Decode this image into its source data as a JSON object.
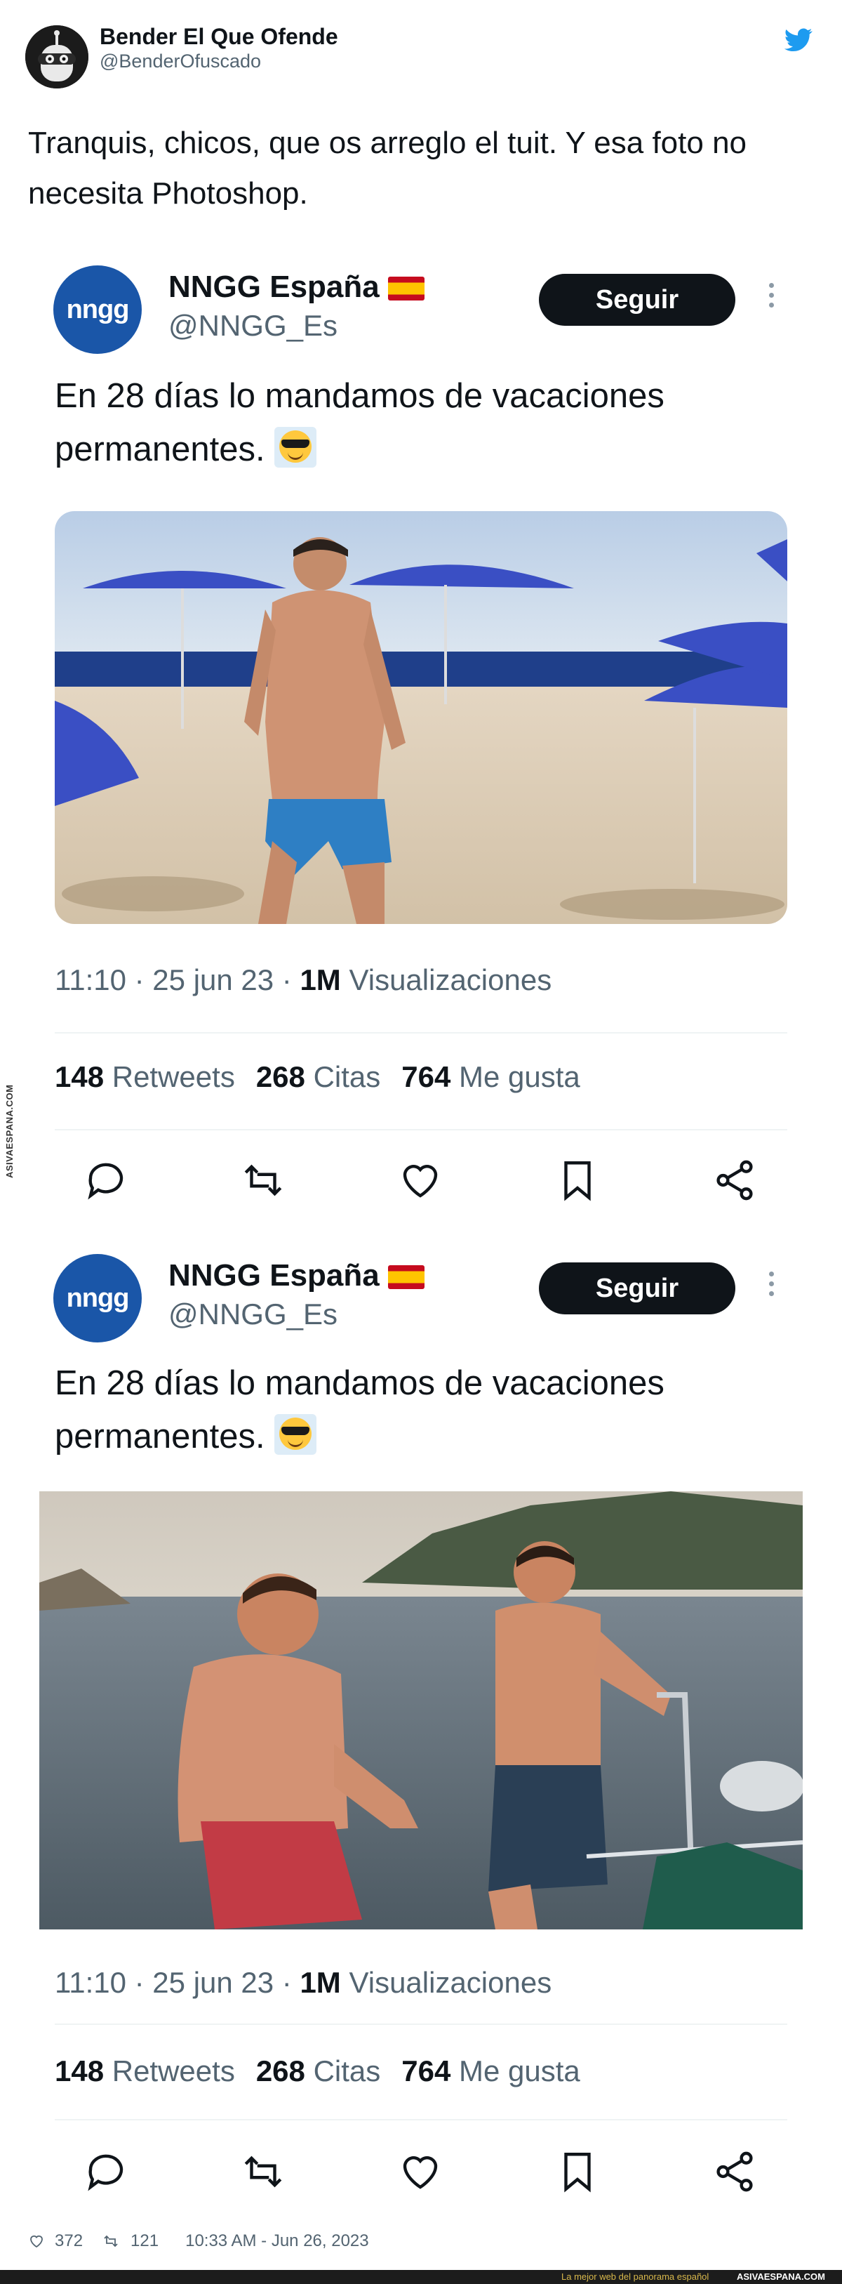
{
  "outer_tweet": {
    "author_name": "Bender El Que Ofende",
    "author_handle": "@BenderOfuscado",
    "text": "Tranquis, chicos, que os arreglo el tuit. Y esa foto no necesita Photoshop.",
    "likes": "372",
    "retweets": "121",
    "timestamp": "10:33 AM - Jun 26, 2023"
  },
  "quoted_tweets": [
    {
      "avatar_label": "nngg",
      "author_name": "NNGG España",
      "author_handle": "@NNGG_Es",
      "follow_label": "Seguir",
      "text": "En 28 días lo mandamos de vacaciones permanentes.",
      "time": "11:10 · 25 jun 23 · ",
      "views_count": "1M",
      "views_label": " Visualizaciones",
      "retweets_count": "148",
      "retweets_label": " Retweets",
      "quotes_count": "268",
      "quotes_label": " Citas",
      "likes_count": "764",
      "likes_label": " Me gusta"
    },
    {
      "avatar_label": "nngg",
      "author_name": "NNGG España",
      "author_handle": "@NNGG_Es",
      "follow_label": "Seguir",
      "text": "En 28 días lo mandamos de vacaciones permanentes.",
      "time": "11:10 · 25 jun 23 · ",
      "views_count": "1M",
      "views_label": " Visualizaciones",
      "retweets_count": "148",
      "retweets_label": " Retweets",
      "quotes_count": "268",
      "quotes_label": " Citas",
      "likes_count": "764",
      "likes_label": " Me gusta"
    }
  ],
  "watermark": {
    "side": "ASIVAESPANA.COM",
    "footer_tagline": "La mejor web del panorama español",
    "footer_site": "ASIVAESPANA.COM"
  },
  "icons": [
    "twitter-bird-icon",
    "reply-icon",
    "retweet-icon",
    "like-icon",
    "bookmark-icon",
    "share-icon",
    "more-icon",
    "flag-spain-icon",
    "sunglasses-emoji-icon"
  ],
  "colors": {
    "twitter_blue": "#1d9bf0",
    "text": "#0f1419",
    "muted": "#536471",
    "nngg_blue": "#1a56a8",
    "follow_button": "#0f1419"
  }
}
